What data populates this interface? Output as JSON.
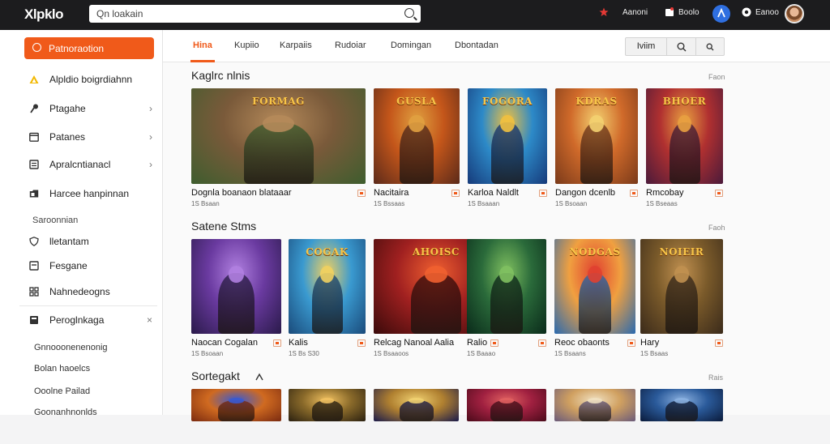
{
  "app": {
    "logo": "Xlpklo",
    "search_placeholder": "Qn loakain"
  },
  "topbar": {
    "items": [
      {
        "label": "Aanoni",
        "icon": "star-icon"
      },
      {
        "label": "Boolo",
        "icon": "bell-icon"
      },
      {
        "label": "",
        "icon": "user-circle-icon"
      },
      {
        "label": "Eanoo",
        "icon": "settings-icon"
      }
    ]
  },
  "sidebar": {
    "primary_button": "Patnoraotion",
    "items": [
      {
        "label": "Alpldio boigrdiahnn",
        "icon": "triangle-icon",
        "chevron": ""
      },
      {
        "label": "Ptagahe",
        "icon": "pin-icon",
        "chevron": "›"
      },
      {
        "label": "Patanes",
        "icon": "calendar-icon",
        "chevron": "›"
      },
      {
        "label": "Apralcntianacl",
        "icon": "document-icon",
        "chevron": "›"
      },
      {
        "label": "Harcee hanpinnan",
        "icon": "folder-icon",
        "chevron": ""
      }
    ],
    "section_label": "Saroonnian",
    "section_items": [
      {
        "label": "lletantam",
        "icon": "shield-icon"
      },
      {
        "label": "Fesgane",
        "icon": "list-icon"
      },
      {
        "label": "Nahnedeogns",
        "icon": "grid-icon"
      }
    ],
    "group": {
      "label": "Peroglnkaga",
      "icon": "bookmark-icon",
      "chevron": "×"
    },
    "sub_items": [
      "Gnnooonenenonig",
      "Bolan haoelcs",
      "Ooolne Pailad",
      "Goonanhnonlds"
    ]
  },
  "tabs": [
    "Hina",
    "Kupiio",
    "Karpaiis",
    "Rudoiar",
    "Domingan",
    "Dbontadan"
  ],
  "viewbar": {
    "label": "Iviim"
  },
  "sections": [
    {
      "title": "Kaglrc nlnis",
      "more": "Faon",
      "cards": [
        {
          "title": "Dognla boanaon blataaar",
          "sub": "1S Bsaan",
          "logo": "FORMAG",
          "colors": [
            "#3e5d2e",
            "#7a5a3a",
            "#b58a5a"
          ]
        },
        {
          "title": "Nacitaira",
          "sub": "1S Bssaas",
          "logo": "GUSLA",
          "colors": [
            "#5b2a1a",
            "#c4561a",
            "#e0a040"
          ]
        },
        {
          "title": "Karloa Naldlt",
          "sub": "1S Bsaaan",
          "logo": "FOGORA",
          "colors": [
            "#163a7a",
            "#2d8ac8",
            "#f0c040"
          ]
        },
        {
          "title": "Dangon dcenlb",
          "sub": "1S Bsoaan",
          "logo": "KDRAS",
          "colors": [
            "#7a3a1a",
            "#d06a2a",
            "#f3d070"
          ]
        },
        {
          "title": "Rmcobay",
          "sub": "1S Bseaas",
          "logo": "BHOER",
          "colors": [
            "#4a1a3a",
            "#b03030",
            "#e8a040"
          ]
        }
      ]
    },
    {
      "title": "Satene Stms",
      "more": "Faoh",
      "cards": [
        {
          "title": "Naocan Cogalan",
          "sub": "1S Bsoaan",
          "logo": "",
          "colors": [
            "#2a1a4a",
            "#6a3aa0",
            "#b080e0"
          ]
        },
        {
          "title": "Kalis",
          "sub": "1S Bs S30",
          "logo": "COGAK",
          "colors": [
            "#1a4a7a",
            "#3a9ad0",
            "#f0d060"
          ]
        },
        {
          "title": "Relcag Nanoal Aalia",
          "sub": "1S Bsaaoos",
          "logo": "AHOISC",
          "colors": [
            "#3a0a0a",
            "#a02020",
            "#f06030"
          ]
        },
        {
          "title": "Ralio",
          "sub": "1S Baaao",
          "logo": "",
          "colors": [
            "#0a2a1a",
            "#2a6a3a",
            "#80c060"
          ]
        },
        {
          "title": "Reoc obaonts",
          "sub": "1S Bsaans",
          "logo": "NODGAS",
          "colors": [
            "#2a6ab0",
            "#f0a040",
            "#e04030"
          ]
        },
        {
          "title": "Hary",
          "sub": "1S Bsaas",
          "logo": "NOIEIR",
          "colors": [
            "#3a2a1a",
            "#7a5a2a",
            "#c09050"
          ]
        }
      ]
    },
    {
      "title": "Sortegakt",
      "more": "Rais",
      "cards": [
        {
          "title": "",
          "sub": "",
          "logo": "",
          "colors": [
            "#7a2a10",
            "#d06a20",
            "#3a5ad0"
          ]
        },
        {
          "title": "",
          "sub": "",
          "logo": "",
          "colors": [
            "#2a2010",
            "#8a6a2a",
            "#f0c060"
          ]
        },
        {
          "title": "",
          "sub": "",
          "logo": "",
          "colors": [
            "#1a1a4a",
            "#b08030",
            "#f0d070"
          ]
        },
        {
          "title": "",
          "sub": "",
          "logo": "",
          "colors": [
            "#4a0a1a",
            "#a02040",
            "#e06060"
          ]
        },
        {
          "title": "",
          "sub": "",
          "logo": "",
          "colors": [
            "#6a5a7a",
            "#d0a060",
            "#f0e0c0"
          ]
        },
        {
          "title": "",
          "sub": "",
          "logo": "",
          "colors": [
            "#0a1a3a",
            "#2a5a9a",
            "#8ab0e0"
          ]
        }
      ]
    }
  ]
}
